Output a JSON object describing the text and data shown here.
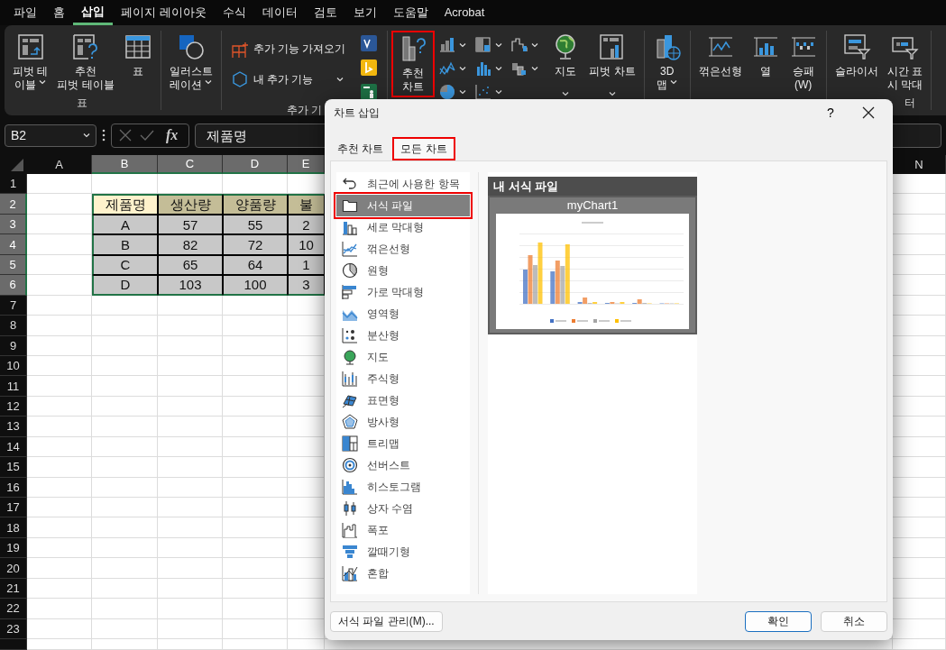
{
  "menu": [
    {
      "label": "파일",
      "selected": false
    },
    {
      "label": "홈",
      "selected": false
    },
    {
      "label": "삽입",
      "selected": true
    },
    {
      "label": "페이지 레이아웃",
      "selected": false
    },
    {
      "label": "수식",
      "selected": false
    },
    {
      "label": "데이터",
      "selected": false
    },
    {
      "label": "검토",
      "selected": false
    },
    {
      "label": "보기",
      "selected": false
    },
    {
      "label": "도움말",
      "selected": false
    },
    {
      "label": "Acrobat",
      "selected": false
    }
  ],
  "ribbon": {
    "groups": [
      {
        "label": "표",
        "buttons": [
          {
            "kind": "large",
            "label": "피벗 테\n이블",
            "dropdown": true,
            "annotated": false
          },
          {
            "kind": "large",
            "label": "추천\n피벗 테이블",
            "dropdown": false,
            "annotated": false
          },
          {
            "kind": "large",
            "label": "표",
            "dropdown": false,
            "annotated": false
          }
        ]
      },
      {
        "buttons": [
          {
            "kind": "large",
            "label": "일러스트\n레이션",
            "dropdown": true,
            "annotated": false
          }
        ]
      },
      {
        "label": "추가 기",
        "buttons": [
          {
            "kind": "small",
            "label": "추가 기능 가져오기",
            "dropdown": false,
            "annotated": false
          },
          {
            "kind": "small",
            "label": "내 추가 기능",
            "dropdown": true,
            "annotated": false
          },
          {
            "kind": "app",
            "dropdown": false,
            "annotated": false
          },
          {
            "kind": "app",
            "dropdown": false,
            "annotated": false
          },
          {
            "kind": "app",
            "dropdown": false,
            "annotated": false
          }
        ]
      },
      {
        "buttons": [
          {
            "kind": "large",
            "label": "추천\n차트",
            "dropdown": false,
            "annotated": true
          },
          {
            "kind": "icon",
            "dropdown": true,
            "annotated": false
          },
          {
            "kind": "icon",
            "dropdown": true,
            "annotated": false
          },
          {
            "kind": "icon",
            "dropdown": true,
            "annotated": false
          },
          {
            "kind": "icon",
            "dropdown": true,
            "annotated": false
          },
          {
            "kind": "icon",
            "dropdown": true,
            "annotated": false
          },
          {
            "kind": "icon",
            "dropdown": true,
            "annotated": false
          },
          {
            "kind": "icon",
            "dropdown": true,
            "annotated": false
          },
          {
            "kind": "icon",
            "dropdown": true,
            "annotated": false
          },
          {
            "kind": "large",
            "label": "지도",
            "dropdown": true,
            "annotated": false
          },
          {
            "kind": "large",
            "label": "피벗 차트",
            "dropdown": true,
            "annotated": false
          }
        ]
      },
      {
        "buttons": [
          {
            "kind": "large",
            "label": "3D\n맵",
            "dropdown": true,
            "annotated": false
          }
        ]
      },
      {
        "buttons": [
          {
            "kind": "large",
            "label": "꺾은선형",
            "dropdown": false,
            "annotated": false
          },
          {
            "kind": "large",
            "label": "열",
            "dropdown": false,
            "annotated": false
          },
          {
            "kind": "large",
            "label": "승패\n(W)",
            "dropdown": false,
            "annotated": false
          }
        ]
      },
      {
        "label": "터",
        "buttons": [
          {
            "kind": "large",
            "label": "슬라이서",
            "dropdown": false,
            "annotated": false
          },
          {
            "kind": "large",
            "label": "시간 표\n시 막대",
            "dropdown": false,
            "annotated": false
          }
        ]
      }
    ]
  },
  "formula_bar": {
    "name_box": "B2",
    "function_label": "fx",
    "value": "제품명"
  },
  "sheet": {
    "columns": [
      {
        "label": "A",
        "selected": false
      },
      {
        "label": "B",
        "selected": true
      },
      {
        "label": "C",
        "selected": true
      },
      {
        "label": "D",
        "selected": true
      },
      {
        "label": "E",
        "selected": true
      },
      {
        "label": "N",
        "selected": false
      }
    ],
    "rows": [
      {
        "label": "1",
        "selected": false
      },
      {
        "label": "2",
        "selected": true,
        "cells": [
          {
            "text": "제품명",
            "kind": "key"
          },
          {
            "text": "생산량",
            "kind": "header"
          },
          {
            "text": "양품량",
            "kind": "header"
          },
          {
            "text": "불",
            "kind": "header"
          }
        ]
      },
      {
        "label": "3",
        "selected": true,
        "cells": [
          {
            "text": "A",
            "kind": "data"
          },
          {
            "text": "57",
            "kind": "data"
          },
          {
            "text": "55",
            "kind": "data"
          },
          {
            "text": "2",
            "kind": "data"
          }
        ]
      },
      {
        "label": "4",
        "selected": true,
        "cells": [
          {
            "text": "B",
            "kind": "data"
          },
          {
            "text": "82",
            "kind": "data"
          },
          {
            "text": "72",
            "kind": "data"
          },
          {
            "text": "10",
            "kind": "data"
          }
        ]
      },
      {
        "label": "5",
        "selected": true,
        "cells": [
          {
            "text": "C",
            "kind": "data"
          },
          {
            "text": "65",
            "kind": "data"
          },
          {
            "text": "64",
            "kind": "data"
          },
          {
            "text": "1",
            "kind": "data"
          }
        ]
      },
      {
        "label": "6",
        "selected": true,
        "cells": [
          {
            "text": "D",
            "kind": "data"
          },
          {
            "text": "103",
            "kind": "data"
          },
          {
            "text": "100",
            "kind": "data"
          },
          {
            "text": "3",
            "kind": "data"
          }
        ]
      },
      {
        "label": "7",
        "selected": false
      },
      {
        "label": "8",
        "selected": false
      },
      {
        "label": "9",
        "selected": false
      },
      {
        "label": "10",
        "selected": false
      },
      {
        "label": "11",
        "selected": false
      },
      {
        "label": "12",
        "selected": false
      },
      {
        "label": "13",
        "selected": false
      },
      {
        "label": "14",
        "selected": false
      },
      {
        "label": "15",
        "selected": false
      },
      {
        "label": "16",
        "selected": false
      },
      {
        "label": "17",
        "selected": false
      },
      {
        "label": "18",
        "selected": false
      },
      {
        "label": "19",
        "selected": false
      },
      {
        "label": "20",
        "selected": false
      },
      {
        "label": "21",
        "selected": false
      },
      {
        "label": "22",
        "selected": false
      },
      {
        "label": "23",
        "selected": false
      }
    ]
  },
  "dialog": {
    "title": "차트 삽입",
    "help": "?",
    "tabs": [
      {
        "label": "추천 차트",
        "selected": false,
        "annotated": false
      },
      {
        "label": "모든 차트",
        "selected": true,
        "annotated": true
      }
    ],
    "chart_types": [
      {
        "label": "최근에 사용한 항목",
        "selected": false,
        "annotated": false
      },
      {
        "label": "서식 파일",
        "selected": true,
        "annotated": true
      },
      {
        "label": "세로 막대형",
        "selected": false,
        "annotated": false
      },
      {
        "label": "꺾은선형",
        "selected": false,
        "annotated": false
      },
      {
        "label": "원형",
        "selected": false,
        "annotated": false
      },
      {
        "label": "가로 막대형",
        "selected": false,
        "annotated": false
      },
      {
        "label": "영역형",
        "selected": false,
        "annotated": false
      },
      {
        "label": "분산형",
        "selected": false,
        "annotated": false
      },
      {
        "label": "지도",
        "selected": false,
        "annotated": false
      },
      {
        "label": "주식형",
        "selected": false,
        "annotated": false
      },
      {
        "label": "표면형",
        "selected": false,
        "annotated": false
      },
      {
        "label": "방사형",
        "selected": false,
        "annotated": false
      },
      {
        "label": "트리맵",
        "selected": false,
        "annotated": false
      },
      {
        "label": "선버스트",
        "selected": false,
        "annotated": false
      },
      {
        "label": "히스토그램",
        "selected": false,
        "annotated": false
      },
      {
        "label": "상자 수염",
        "selected": false,
        "annotated": false
      },
      {
        "label": "폭포",
        "selected": false,
        "annotated": false
      },
      {
        "label": "깔때기형",
        "selected": false,
        "annotated": false
      },
      {
        "label": "혼합",
        "selected": false,
        "annotated": false
      }
    ],
    "template_header": "내 서식 파일",
    "templates": [
      {
        "name": "myChart1",
        "selected": true
      }
    ],
    "buttons": [
      {
        "label": "서식 파일 관리(M)...",
        "kind": "manage"
      },
      {
        "label": "확인",
        "kind": "default"
      },
      {
        "label": "취소",
        "kind": "normal"
      }
    ]
  }
}
